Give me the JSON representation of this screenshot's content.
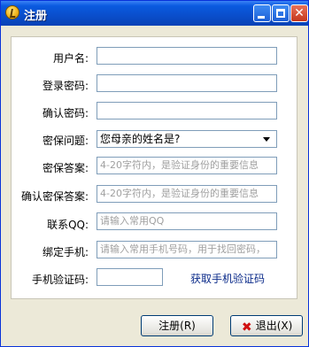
{
  "window": {
    "title": "注册",
    "close_glyph": "✕"
  },
  "form": {
    "username": {
      "label": "用户名:",
      "value": ""
    },
    "password": {
      "label": "登录密码:",
      "value": ""
    },
    "confirm_password": {
      "label": "确认密码:",
      "value": ""
    },
    "security_question": {
      "label": "密保问题:",
      "selected": "您母亲的姓名是?"
    },
    "security_answer": {
      "label": "密保答案:",
      "placeholder": "4-20字符内，是验证身份的重要信息"
    },
    "confirm_security_answer": {
      "label": "确认密保答案:",
      "placeholder": "4-20字符内，是验证身份的重要信息"
    },
    "qq": {
      "label": "联系QQ:",
      "placeholder": "请输入常用QQ"
    },
    "phone": {
      "label": "绑定手机:",
      "placeholder": "请输入常用手机号码，用于找回密码，"
    },
    "sms_code": {
      "label": "手机验证码:",
      "value": ""
    },
    "get_code_link": "获取手机验证码"
  },
  "buttons": {
    "register": "注册(R)",
    "exit": "退出(X)",
    "exit_icon_glyph": "✖"
  },
  "icons": {
    "app": "app-logo-icon",
    "minimize": "minimize-icon",
    "maximize": "maximize-icon",
    "close": "close-icon",
    "dropdown": "chevron-down-icon",
    "exit": "x-mark-icon"
  }
}
